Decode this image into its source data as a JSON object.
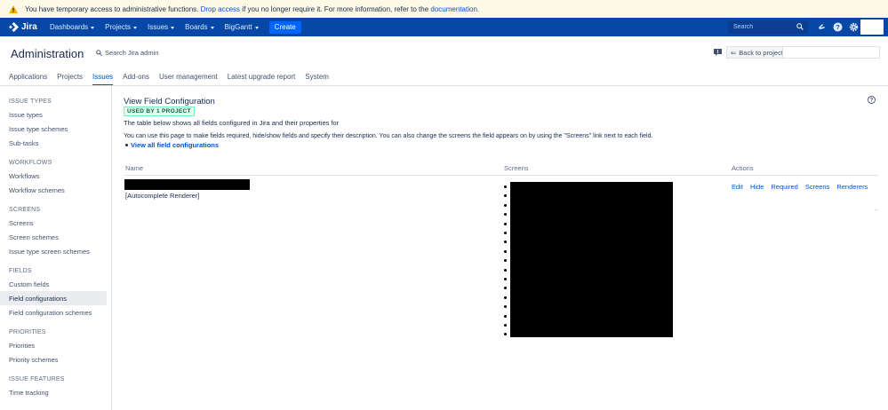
{
  "banner": {
    "text_before": "You have temporary access to administrative functions.",
    "drop_access_link": "Drop access",
    "text_middle": "if you no longer require it. For more information, refer to the",
    "documentation_link": "documentation",
    "text_end": "."
  },
  "topnav": {
    "logo_text": "Jira",
    "menu": [
      {
        "label": "Dashboards"
      },
      {
        "label": "Projects"
      },
      {
        "label": "Issues"
      },
      {
        "label": "Boards"
      },
      {
        "label": "BigGantt"
      }
    ],
    "create_label": "Create",
    "search_placeholder": "Search"
  },
  "admin": {
    "title": "Administration",
    "search_placeholder": "Search Jira admin",
    "back_label": "Back to project:"
  },
  "tabs": [
    {
      "label": "Applications",
      "active": false
    },
    {
      "label": "Projects",
      "active": false
    },
    {
      "label": "Issues",
      "active": true
    },
    {
      "label": "Add-ons",
      "active": false
    },
    {
      "label": "User management",
      "active": false
    },
    {
      "label": "Latest upgrade report",
      "active": false
    },
    {
      "label": "System",
      "active": false
    }
  ],
  "sidebar": {
    "sections": [
      {
        "title": "ISSUE TYPES",
        "items": [
          "Issue types",
          "Issue type schemes",
          "Sub-tasks"
        ]
      },
      {
        "title": "WORKFLOWS",
        "items": [
          "Workflows",
          "Workflow schemes"
        ]
      },
      {
        "title": "SCREENS",
        "items": [
          "Screens",
          "Screen schemes",
          "Issue type screen schemes"
        ]
      },
      {
        "title": "FIELDS",
        "items": [
          "Custom fields",
          "Field configurations",
          "Field configuration schemes"
        ]
      },
      {
        "title": "PRIORITIES",
        "items": [
          "Priorities",
          "Priority schemes"
        ]
      },
      {
        "title": "ISSUE FEATURES",
        "items": [
          "Time tracking"
        ]
      }
    ],
    "selected": "Field configurations"
  },
  "main": {
    "heading": "View Field Configuration",
    "lozenge": "USED BY 1 PROJECT",
    "desc1": "The table below shows all fields configured in Jira and their properties for",
    "desc2": "You can use this page to make fields required, hide/show fields and specify their description. You can also change the screens the field appears on by using the \"Screens\" link next to each field.",
    "view_all_link": "View all field configurations",
    "table": {
      "headers": {
        "name": "Name",
        "screens": "Screens",
        "actions": "Actions"
      },
      "row": {
        "renderer": "[Autocomplete Renderer]",
        "screen_count": 17,
        "actions": [
          "Edit",
          "Hide",
          "Required",
          "Screens",
          "Renderers"
        ]
      }
    }
  },
  "colors": {
    "nav_bg": "#0747a6",
    "banner_bg": "#fffae6",
    "link": "#0052cc",
    "lozenge_bg": "#e3fcef",
    "lozenge_text": "#006644"
  }
}
